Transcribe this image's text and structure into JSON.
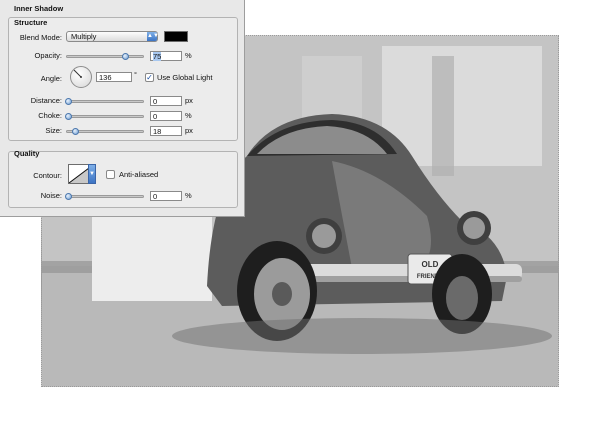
{
  "dialog": {
    "title": "Inner Shadow",
    "structure": {
      "group_title": "Structure",
      "blend_mode": {
        "label": "Blend Mode:",
        "value": "Multiply",
        "swatch_color": "#000000"
      },
      "opacity": {
        "label": "Opacity:",
        "value": "75",
        "unit": "%",
        "level": 0.75
      },
      "angle": {
        "label": "Angle:",
        "value": "136",
        "unit": "°",
        "use_global_light_label": "Use Global Light",
        "use_global_light_checked": true
      },
      "distance": {
        "label": "Distance:",
        "value": "0",
        "unit": "px",
        "level": 0
      },
      "choke": {
        "label": "Choke:",
        "value": "0",
        "unit": "%",
        "level": 0
      },
      "size": {
        "label": "Size:",
        "value": "18",
        "unit": "px",
        "level": 0.07
      }
    },
    "quality": {
      "group_title": "Quality",
      "contour": {
        "label": "Contour:",
        "anti_aliased_label": "Anti-aliased",
        "anti_aliased_checked": false
      },
      "noise": {
        "label": "Noise:",
        "value": "0",
        "unit": "%",
        "level": 0
      }
    }
  },
  "photo": {
    "description_icon": "vintage-beetle-car-photo",
    "license_plate_text_top": "OLD",
    "license_plate_text_bottom": "FRIENDS"
  }
}
